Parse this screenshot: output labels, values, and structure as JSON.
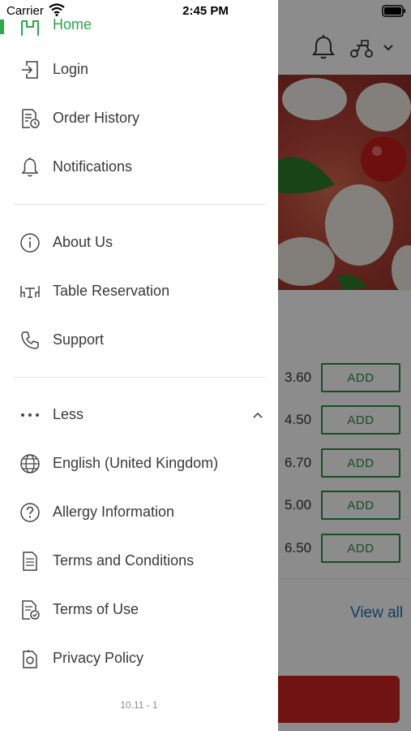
{
  "status_bar": {
    "carrier": "Carrier",
    "time": "2:45 PM"
  },
  "drawer": {
    "home_label": "Home",
    "primary_items": [
      {
        "label": "Login",
        "icon": "login-icon"
      },
      {
        "label": "Order History",
        "icon": "order-history-icon"
      },
      {
        "label": "Notifications",
        "icon": "bell-icon"
      }
    ],
    "secondary_items": [
      {
        "label": "About Us",
        "icon": "info-icon"
      },
      {
        "label": "Table Reservation",
        "icon": "table-icon"
      },
      {
        "label": "Support",
        "icon": "phone-icon"
      }
    ],
    "less_label": "Less",
    "more_items": [
      {
        "label": "English (United Kingdom)",
        "icon": "globe-icon"
      },
      {
        "label": "Allergy Information",
        "icon": "question-icon"
      },
      {
        "label": "Terms and Conditions",
        "icon": "document-icon"
      },
      {
        "label": "Terms of Use",
        "icon": "document-check-icon"
      },
      {
        "label": "Privacy Policy",
        "icon": "privacy-icon"
      }
    ],
    "version": "10.11 - 1"
  },
  "background": {
    "prices": [
      "3.60",
      "4.50",
      "6.70",
      "5.00",
      "6.50"
    ],
    "add_label": "ADD",
    "view_all": "View all"
  },
  "colors": {
    "accent": "#2aa84a",
    "add_button": "#2e8a4a",
    "link": "#1f6fb8",
    "cta": "#cc2424"
  }
}
